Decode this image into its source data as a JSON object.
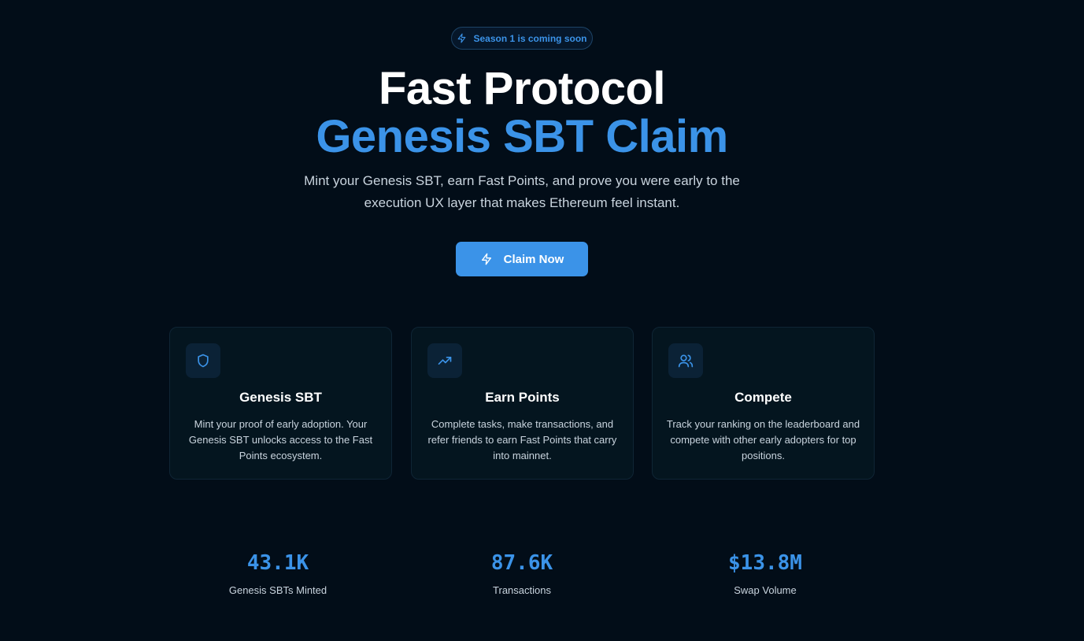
{
  "badge": {
    "label": "Season 1 is coming soon",
    "icon": "lightning-icon"
  },
  "hero": {
    "title": "Fast Protocol",
    "subtitle": "Genesis SBT Claim",
    "description": "Mint your Genesis SBT, earn Fast Points, and prove you were early to the execution UX layer that makes Ethereum feel instant."
  },
  "cta": {
    "label": "Claim Now",
    "icon": "lightning-icon"
  },
  "features": [
    {
      "icon": "shield-icon",
      "title": "Genesis SBT",
      "text": "Mint your proof of early adoption. Your Genesis SBT unlocks access to the Fast Points ecosystem."
    },
    {
      "icon": "trending-up-icon",
      "title": "Earn Points",
      "text": "Complete tasks, make transactions, and refer friends to earn Fast Points that carry into mainnet."
    },
    {
      "icon": "users-icon",
      "title": "Compete",
      "text": "Track your ranking on the leaderboard and compete with other early adopters for top positions."
    }
  ],
  "stats": [
    {
      "value": "43.1K",
      "label": "Genesis SBTs Minted"
    },
    {
      "value": "87.6K",
      "label": "Transactions"
    },
    {
      "value": "$13.8M",
      "label": "Swap Volume"
    }
  ],
  "colors": {
    "background": "#020d18",
    "accent": "#3b93e8",
    "card": "#04151f"
  }
}
